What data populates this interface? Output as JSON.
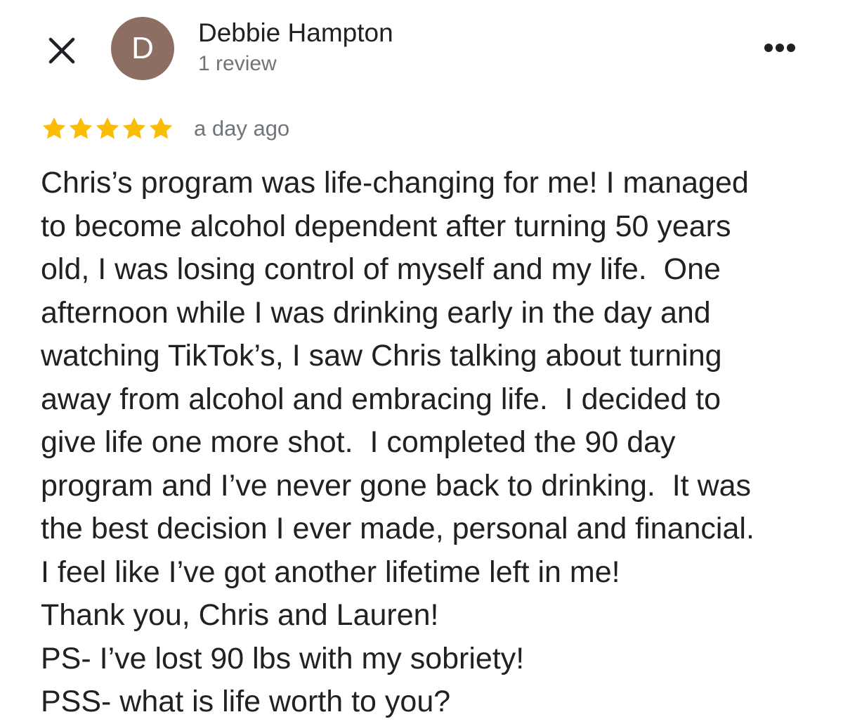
{
  "header": {
    "close_icon": "close-icon",
    "avatar": {
      "letter": "D",
      "color": "#8d6e63"
    },
    "author_name": "Debbie Hampton",
    "review_count": "1 review",
    "more_icon": "more-horizontal-icon"
  },
  "rating": {
    "stars": 5,
    "max_stars": 5,
    "star_color": "#fbbc04",
    "date": "a day ago"
  },
  "review": {
    "lines": [
      "Chris’s program was life-changing for me! I managed",
      "to become alcohol dependent after turning 50 years",
      "old, I was losing control of myself and my life.  One",
      "afternoon while I was drinking early in the day and",
      "watching TikTok’s, I saw Chris talking about turning",
      "away from alcohol and embracing life.  I decided to",
      "give life one more shot.  I completed the 90 day",
      "program and I’ve never gone back to drinking.  It was",
      "the best decision I ever made, personal and financial.",
      "I feel like I’ve got another lifetime left in me!",
      "Thank you, Chris and Lauren!",
      "PS- I’ve lost 90 lbs with my sobriety!",
      "PSS- what is life worth to you?"
    ]
  }
}
